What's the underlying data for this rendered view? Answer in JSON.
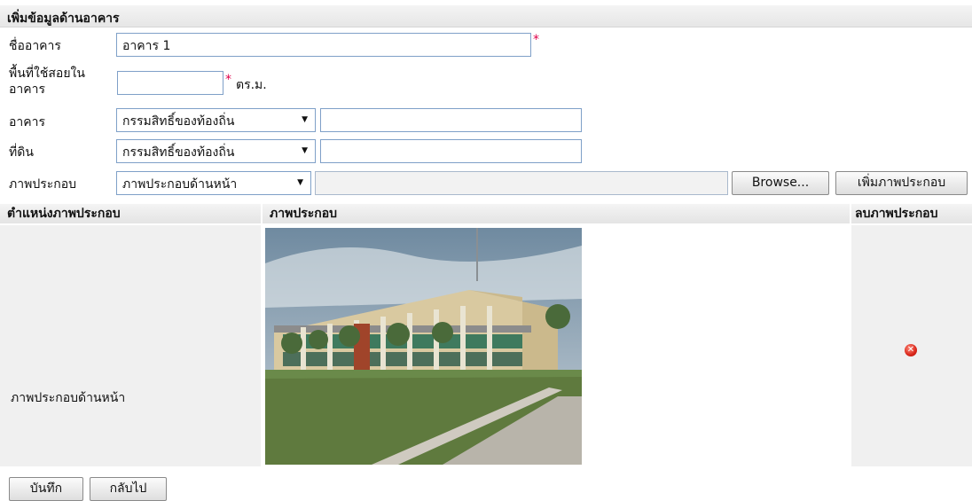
{
  "header": {
    "title": "เพิ่มข้อมูลด้านอาคาร"
  },
  "form": {
    "building_name_label": "ชื่ออาคาร",
    "building_name_value": "อาคาร 1",
    "area_label": "พื้นที่ใช้สอยในอาคาร",
    "area_value": "",
    "area_unit": "ตร.ม.",
    "required_mark": "*",
    "building_label": "อาคาร",
    "building_select": "กรรมสิทธิ์ของท้องถิ่น",
    "building_other": "",
    "land_label": "ที่ดิน",
    "land_select": "กรรมสิทธิ์ของท้องถิ่น",
    "land_other": "",
    "image_label": "ภาพประกอบ",
    "image_select": "ภาพประกอบด้านหน้า",
    "file_path": "",
    "browse_label": "Browse...",
    "add_image_label": "เพิ่มภาพประกอบ"
  },
  "table": {
    "columns": [
      "ตำแหน่งภาพประกอบ",
      "ภาพประกอบ",
      "ลบภาพประกอบ"
    ],
    "rows": [
      {
        "position": "ภาพประกอบด้านหน้า",
        "delete_icon": "delete-red-circle-icon"
      }
    ]
  },
  "actions": {
    "save_label": "บันทึก",
    "back_label": "กลับไป"
  },
  "colors": {
    "required": "#e0004a",
    "input_border": "#7fa0c8",
    "delete": "#d9261a"
  }
}
